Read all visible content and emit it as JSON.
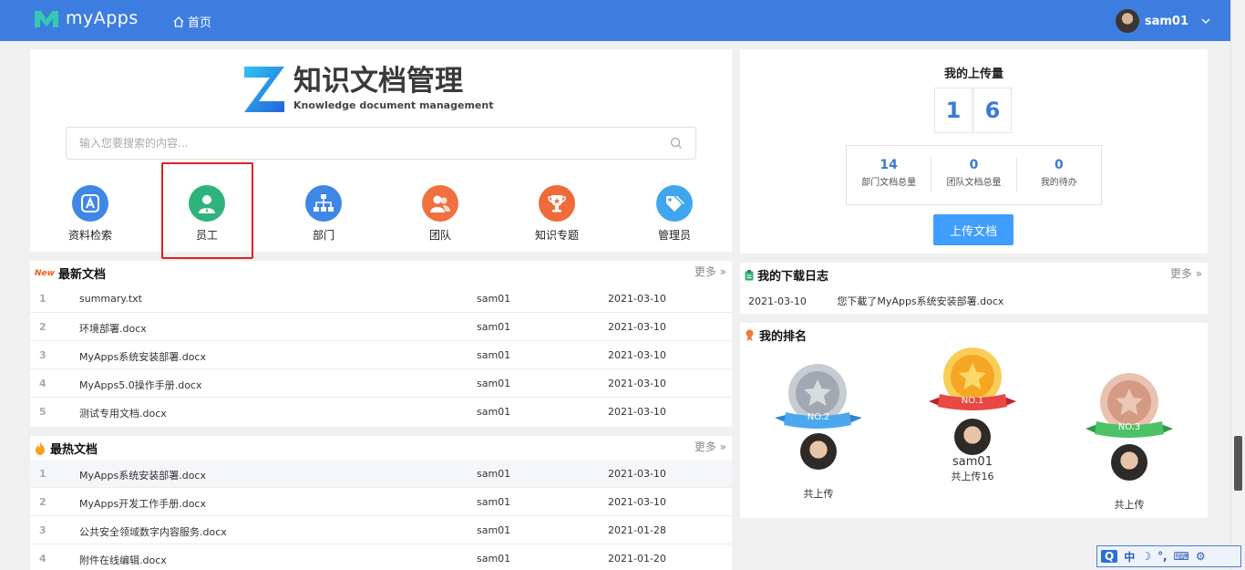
{
  "header": {
    "app_name": "myApps",
    "nav_home": "首页",
    "username": "sam01",
    "colors": {
      "bar": "#3d7de0"
    }
  },
  "brand": {
    "title": "知识文档管理",
    "subtitle": "Knowledge document management"
  },
  "search": {
    "placeholder": "输入您要搜索的内容..."
  },
  "quick_nav": [
    {
      "label": "资料检索",
      "icon": "search-doc-icon",
      "color": "#3f87e6"
    },
    {
      "label": "员工",
      "icon": "employee-icon",
      "color": "#2fb37c"
    },
    {
      "label": "部门",
      "icon": "org-chart-icon",
      "color": "#3f87e6"
    },
    {
      "label": "团队",
      "icon": "team-icon",
      "color": "#f07040"
    },
    {
      "label": "知识专题",
      "icon": "trophy-icon",
      "color": "#f06a3a"
    },
    {
      "label": "管理员",
      "icon": "tag-icon",
      "color": "#3fa6ee"
    }
  ],
  "upload_stats": {
    "title": "我的上传量",
    "digits": [
      "1",
      "6"
    ],
    "stats": [
      {
        "value": "14",
        "label": "部门文档总量"
      },
      {
        "value": "0",
        "label": "团队文档总量"
      },
      {
        "value": "0",
        "label": "我的待办"
      }
    ],
    "button": "上传文档"
  },
  "latest_docs": {
    "badge": "New",
    "title": "最新文档",
    "more": "更多",
    "rows": [
      {
        "n": "1",
        "name": "summary.txt",
        "author": "sam01",
        "date": "2021-03-10"
      },
      {
        "n": "2",
        "name": "环境部署.docx",
        "author": "sam01",
        "date": "2021-03-10"
      },
      {
        "n": "3",
        "name": "MyApps系统安装部署.docx",
        "author": "sam01",
        "date": "2021-03-10"
      },
      {
        "n": "4",
        "name": "MyApps5.0操作手册.docx",
        "author": "sam01",
        "date": "2021-03-10"
      },
      {
        "n": "5",
        "name": "测试专用文档.docx",
        "author": "sam01",
        "date": "2021-03-10"
      }
    ]
  },
  "hot_docs": {
    "title": "最热文档",
    "more": "更多",
    "rows": [
      {
        "n": "1",
        "name": "MyApps系统安装部署.docx",
        "author": "sam01",
        "date": "2021-03-10"
      },
      {
        "n": "2",
        "name": "MyApps开发工作手册.docx",
        "author": "sam01",
        "date": "2021-03-10"
      },
      {
        "n": "3",
        "name": "公共安全领域数字内容服务.docx",
        "author": "sam01",
        "date": "2021-01-28"
      },
      {
        "n": "4",
        "name": "附件在线编辑.docx",
        "author": "sam01",
        "date": "2021-01-20"
      }
    ]
  },
  "download_log": {
    "title": "我的下载日志",
    "more": "更多",
    "entries": [
      {
        "date": "2021-03-10",
        "text": "您下載了MyApps系统安装部署.docx"
      }
    ]
  },
  "ranking": {
    "title": "我的排名",
    "places": [
      {
        "badge": "NO.2",
        "name": "",
        "count": "共上传",
        "medal": "#b8bcc4",
        "ribbon": "#3fa3ea"
      },
      {
        "badge": "NO.1",
        "name": "sam01",
        "count": "共上传16",
        "medal": "#f5b631",
        "ribbon": "#e94845"
      },
      {
        "badge": "NO.3",
        "name": "",
        "count": "共上传",
        "medal": "#d9a894",
        "ribbon": "#4cc266"
      }
    ]
  },
  "ime": {
    "items": [
      "中",
      "☽",
      "°,",
      "⌨",
      "⚙"
    ]
  }
}
